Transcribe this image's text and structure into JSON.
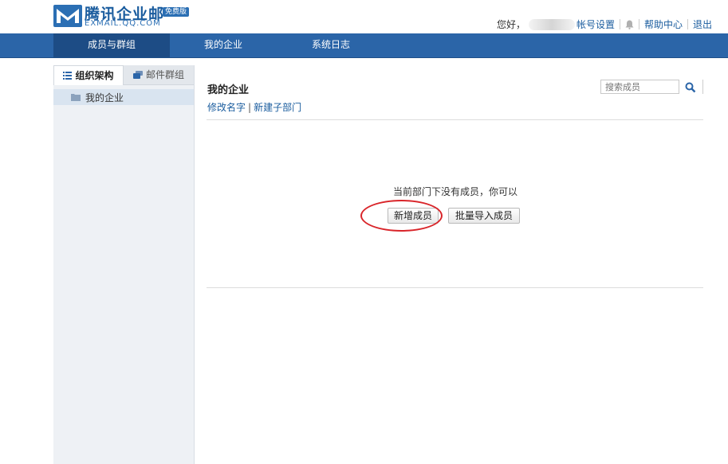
{
  "brand": {
    "name": "腾讯企业邮",
    "badge": "免费版",
    "domain": "EXMAIL.QQ.COM",
    "color": "#1a5c9e"
  },
  "user_links": {
    "greeting": "您好，",
    "account_settings": "帐号设置",
    "help_center": "帮助中心",
    "logout": "退出"
  },
  "nav": {
    "tabs": [
      {
        "label": "成员与群组",
        "active": true
      },
      {
        "label": "我的企业",
        "active": false
      },
      {
        "label": "系统日志",
        "active": false
      }
    ],
    "bg_color": "#2b65a8",
    "active_color": "#1d4c85"
  },
  "sidebar": {
    "tabs": [
      {
        "label": "组织架构",
        "icon": "list-icon",
        "active": true
      },
      {
        "label": "邮件群组",
        "icon": "group-mail-icon",
        "active": false
      }
    ],
    "tree": [
      {
        "label": "我的企业",
        "icon": "folder-icon",
        "selected": true
      }
    ]
  },
  "main": {
    "title": "我的企业",
    "actions": {
      "rename": "修改名字",
      "separator": "|",
      "new_subdept": "新建子部门"
    },
    "search": {
      "placeholder": "搜索成员",
      "icon": "search-icon"
    },
    "empty_message": "当前部门下没有成员，你可以",
    "buttons": {
      "add_member": "新增成员",
      "bulk_import": "批量导入成员"
    },
    "highlight_color": "#d9252a"
  }
}
